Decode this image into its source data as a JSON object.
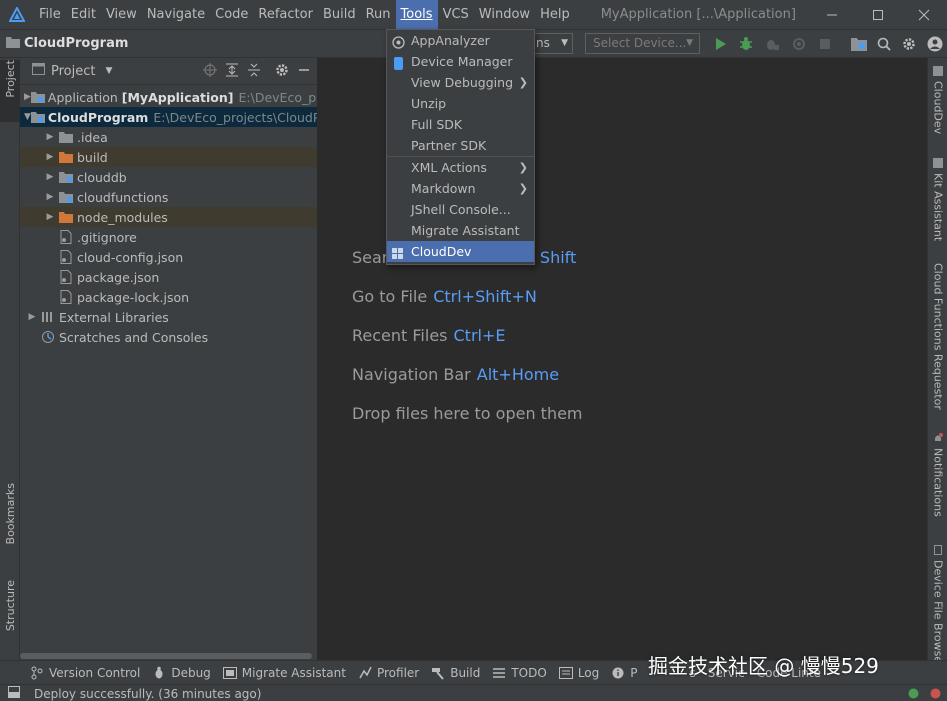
{
  "menubar": {
    "items": [
      "File",
      "Edit",
      "View",
      "Navigate",
      "Code",
      "Refactor",
      "Build",
      "Run",
      "Tools",
      "VCS",
      "Window",
      "Help"
    ],
    "active_index": 8,
    "window_title": "MyApplication [...\\Application]"
  },
  "navbar": {
    "project_name": "CloudProgram",
    "run_config_fragment": "ns",
    "device_placeholder": "Select Device..."
  },
  "project_panel": {
    "title": "Project",
    "tree": [
      {
        "label": "Application",
        "bold_suffix": "[MyApplication]",
        "path": "E:\\DevEco_pro",
        "indent": 0,
        "arrow": "right",
        "icon": "module"
      },
      {
        "label": "CloudProgram",
        "bold_suffix": "",
        "path": "E:\\DevEco_projects\\CloudPr",
        "indent": 0,
        "arrow": "down",
        "icon": "module",
        "selected": true
      },
      {
        "label": ".idea",
        "indent": 1,
        "arrow": "right",
        "icon": "folder"
      },
      {
        "label": "build",
        "indent": 1,
        "arrow": "right",
        "icon": "folder-orange",
        "excluded": true
      },
      {
        "label": "clouddb",
        "indent": 1,
        "arrow": "right",
        "icon": "folder"
      },
      {
        "label": "cloudfunctions",
        "indent": 1,
        "arrow": "right",
        "icon": "folder"
      },
      {
        "label": "node_modules",
        "indent": 1,
        "arrow": "right",
        "icon": "folder-orange",
        "excluded": true
      },
      {
        "label": ".gitignore",
        "indent": 1,
        "arrow": "",
        "icon": "file"
      },
      {
        "label": "cloud-config.json",
        "indent": 1,
        "arrow": "",
        "icon": "file"
      },
      {
        "label": "package.json",
        "indent": 1,
        "arrow": "",
        "icon": "file"
      },
      {
        "label": "package-lock.json",
        "indent": 1,
        "arrow": "",
        "icon": "file"
      },
      {
        "label": "External Libraries",
        "indent": 0,
        "arrow": "right",
        "icon": "library"
      },
      {
        "label": "Scratches and Consoles",
        "indent": 0,
        "arrow": "",
        "icon": "scratch"
      }
    ]
  },
  "left_stripe": {
    "project": "Project",
    "bookmarks": "Bookmarks",
    "structure": "Structure"
  },
  "right_stripe": {
    "tabs": [
      "CloudDev",
      "Kit Assistant",
      "Cloud Functions Requestor",
      "Notifications",
      "Device File Browser"
    ]
  },
  "editor_hints": [
    {
      "label": "Sear",
      "key": "ble Shift"
    },
    {
      "label": "Go to File",
      "key": "Ctrl+Shift+N"
    },
    {
      "label": "Recent Files",
      "key": "Ctrl+E"
    },
    {
      "label": "Navigation Bar",
      "key": "Alt+Home"
    },
    {
      "label": "Drop files here to open them",
      "key": ""
    }
  ],
  "tools_menu": {
    "items": [
      {
        "label": "AppAnalyzer",
        "icon": "app-analyzer",
        "submenu": false
      },
      {
        "label": "Device Manager",
        "icon": "device-manager",
        "submenu": false
      },
      {
        "label": "View Debugging",
        "icon": "",
        "submenu": true
      },
      {
        "label": "Unzip",
        "icon": "",
        "submenu": false
      },
      {
        "label": "Full SDK",
        "icon": "",
        "submenu": false
      },
      {
        "label": "Partner SDK",
        "icon": "",
        "submenu": false
      },
      {
        "label": "XML Actions",
        "icon": "",
        "submenu": true
      },
      {
        "label": "Markdown",
        "icon": "",
        "submenu": true
      },
      {
        "label": "JShell Console...",
        "icon": "",
        "submenu": false
      },
      {
        "label": "Migrate Assistant",
        "icon": "",
        "submenu": false
      },
      {
        "label": "CloudDev",
        "icon": "clouddev",
        "submenu": false,
        "active": true
      }
    ]
  },
  "bottom_bar": {
    "tabs": [
      "Version Control",
      "Debug",
      "Migrate Assistant",
      "Profiler",
      "Build",
      "TODO",
      "Log",
      "P",
      "s",
      "Servic",
      "Code Linte"
    ]
  },
  "status_bar": {
    "message": "Deploy successfully. (36 minutes ago)"
  },
  "watermark": "掘金技术社区 @ 慢慢529",
  "colors": {
    "accent": "#4b6eaf",
    "link": "#589df6",
    "run_green": "#499c54",
    "selected_row": "#0d293e"
  }
}
